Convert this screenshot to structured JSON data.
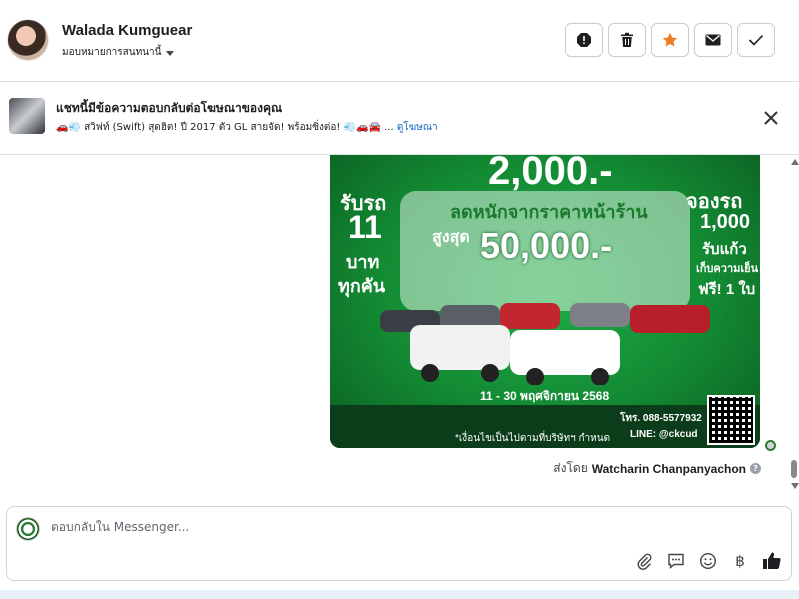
{
  "header": {
    "contact_name": "Walada Kumguear",
    "assign_label": "มอบหมายการสนทนานี้",
    "actions": [
      {
        "icon": "spam-alert-icon"
      },
      {
        "icon": "trash-icon"
      },
      {
        "icon": "star-icon",
        "color": "#f07c22"
      },
      {
        "icon": "mail-icon"
      },
      {
        "icon": "checkmark-icon"
      }
    ]
  },
  "ad_banner": {
    "title": "แชทนี้มีข้อความตอบกลับต่อโฆษณาของคุณ",
    "snippet": "🚗💨 สวิฟท์ (Swift) สุดฮิต! ปี 2017 ตัว GL สายจัด! พร้อมซิ่งต่อ! 💨🚗🚘 ...",
    "link_label": "ดูโฆษณา"
  },
  "promo": {
    "top_price": "2,000.-",
    "left_line1": "รับรถ",
    "left_line2": "11",
    "left_line3": "บาท",
    "left_line4": "ทุกคัน",
    "discount_label": "ลดหนักจากราคาหน้าร้าน",
    "max_label": "สูงสุด",
    "max_amount": "50,000.-",
    "right_line1": "จองรถ",
    "right_line2": "1,000",
    "right_line3": "รับแก้ว",
    "right_line4": "เก็บความเย็น",
    "right_line5": "ฟรี! 1 ใบ",
    "date_range": "11 - 30 พฤศจิกายน 2568",
    "phone": "โทร. 088-5577932",
    "line_id": "LINE: @ckcud",
    "disclaimer": "*เงื่อนไขเป็นไปตามที่บริษัทฯ กำหนด"
  },
  "message_meta": {
    "sent_by_prefix": "ส่งโดย",
    "sender": "Watcharin Chanpanyachon"
  },
  "composer": {
    "placeholder": "ตอบกลับใน Messenger...",
    "tools": [
      "attachment-icon",
      "saved-reply-icon",
      "emoji-icon",
      "baht-icon",
      "thumbs-up-icon"
    ],
    "baht_symbol": "฿"
  },
  "colors": {
    "accent_star": "#f07c22",
    "link": "#1565c0",
    "promo_green": "#138a33"
  }
}
